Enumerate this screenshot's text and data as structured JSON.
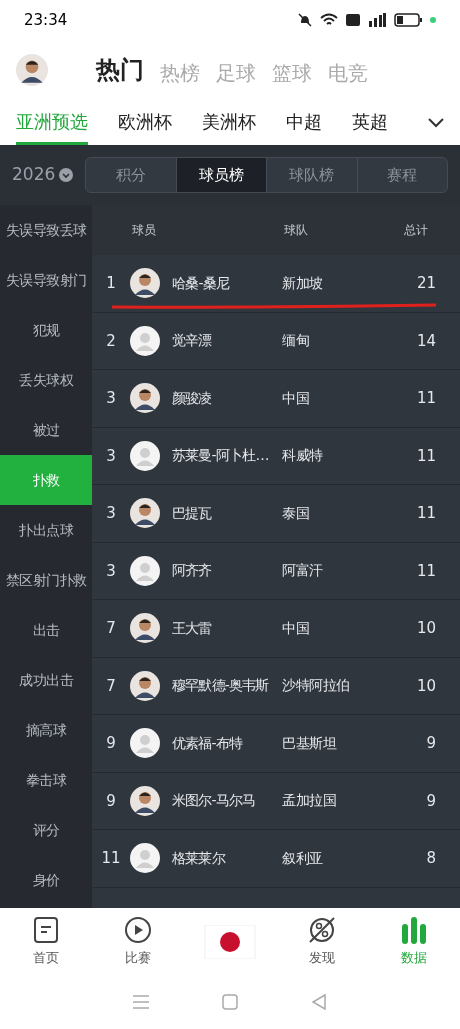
{
  "status_bar": {
    "time": "23:34"
  },
  "top_tabs": [
    {
      "label": "热门",
      "selected": true
    },
    {
      "label": "热榜",
      "selected": false
    },
    {
      "label": "足球",
      "selected": false
    },
    {
      "label": "篮球",
      "selected": false
    },
    {
      "label": "电竞",
      "selected": false
    }
  ],
  "league_tabs": [
    {
      "label": "亚洲预选",
      "selected": true
    },
    {
      "label": "欧洲杯",
      "selected": false
    },
    {
      "label": "美洲杯",
      "selected": false
    },
    {
      "label": "中超",
      "selected": false
    },
    {
      "label": "英超",
      "selected": false
    }
  ],
  "season": "2026",
  "segments": [
    {
      "label": "积分",
      "selected": false
    },
    {
      "label": "球员榜",
      "selected": true
    },
    {
      "label": "球队榜",
      "selected": false
    },
    {
      "label": "赛程",
      "selected": false
    }
  ],
  "categories": [
    {
      "label": "失误导致丢球",
      "selected": false
    },
    {
      "label": "失误导致射门",
      "selected": false
    },
    {
      "label": "犯规",
      "selected": false
    },
    {
      "label": "丢失球权",
      "selected": false
    },
    {
      "label": "被过",
      "selected": false
    },
    {
      "label": "扑救",
      "selected": true
    },
    {
      "label": "扑出点球",
      "selected": false
    },
    {
      "label": "禁区射门扑救",
      "selected": false
    },
    {
      "label": "出击",
      "selected": false
    },
    {
      "label": "成功出击",
      "selected": false
    },
    {
      "label": "摘高球",
      "selected": false
    },
    {
      "label": "拳击球",
      "selected": false
    },
    {
      "label": "评分",
      "selected": false
    },
    {
      "label": "身价",
      "selected": false
    }
  ],
  "table": {
    "columns": [
      "球员",
      "球队",
      "总计"
    ],
    "rows": [
      {
        "rank": "1",
        "photo": true,
        "player": "哈桑-桑尼",
        "team": "新加坡",
        "total": "21"
      },
      {
        "rank": "2",
        "photo": false,
        "player": "觉辛漂",
        "team": "缅甸",
        "total": "14"
      },
      {
        "rank": "3",
        "photo": true,
        "player": "颜骏凌",
        "team": "中国",
        "total": "11"
      },
      {
        "rank": "3",
        "photo": false,
        "player": "苏莱曼-阿卜杜…",
        "team": "科威特",
        "total": "11"
      },
      {
        "rank": "3",
        "photo": true,
        "player": "巴提瓦",
        "team": "泰国",
        "total": "11"
      },
      {
        "rank": "3",
        "photo": false,
        "player": "阿齐齐",
        "team": "阿富汗",
        "total": "11"
      },
      {
        "rank": "7",
        "photo": true,
        "player": "王大雷",
        "team": "中国",
        "total": "10"
      },
      {
        "rank": "7",
        "photo": true,
        "player": "穆罕默德-奥韦斯",
        "team": "沙特阿拉伯",
        "total": "10"
      },
      {
        "rank": "9",
        "photo": false,
        "player": "优素福-布特",
        "team": "巴基斯坦",
        "total": "9"
      },
      {
        "rank": "9",
        "photo": true,
        "player": "米图尔-马尔马",
        "team": "孟加拉国",
        "total": "9"
      },
      {
        "rank": "11",
        "photo": false,
        "player": "格莱莱尔",
        "team": "叙利亚",
        "total": "8"
      }
    ]
  },
  "bottom_nav": [
    {
      "kind": "home",
      "label": "首页",
      "selected": false
    },
    {
      "kind": "match",
      "label": "比赛",
      "selected": false
    },
    {
      "kind": "flag"
    },
    {
      "kind": "discover",
      "label": "发现",
      "selected": false
    },
    {
      "kind": "data",
      "label": "数据",
      "selected": true
    }
  ]
}
